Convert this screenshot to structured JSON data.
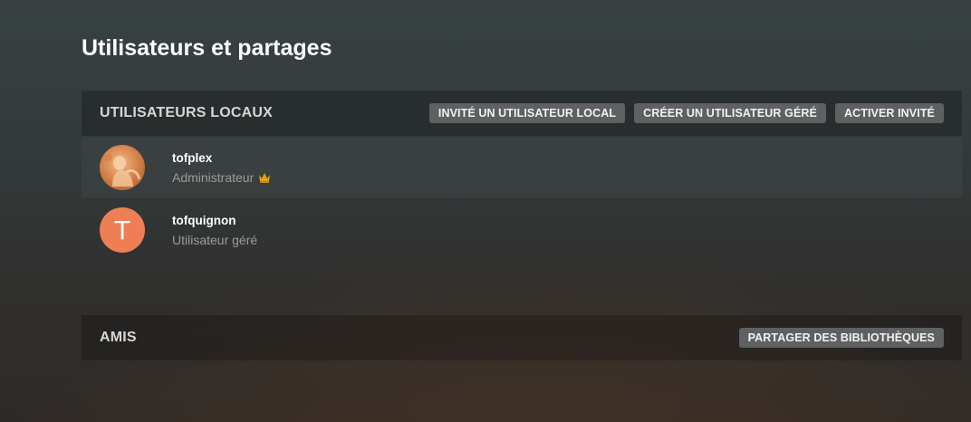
{
  "page": {
    "title": "Utilisateurs et partages"
  },
  "local_users": {
    "title": "UTILISATEURS LOCAUX",
    "actions": {
      "invite_label": "INVITÉ UN UTILISATEUR LOCAL",
      "create_managed_label": "CRÉER UN UTILISATEUR GÉRÉ",
      "enable_guest_label": "ACTIVER INVITÉ"
    },
    "users": [
      {
        "name": "tofplex",
        "role": "Administrateur",
        "avatar": "photo",
        "badge_icon": "crown-icon",
        "badge_color": "#e5a00d"
      },
      {
        "name": "tofquignon",
        "role": "Utilisateur géré",
        "avatar_letter": "T",
        "avatar_color": "#ee7f55"
      }
    ]
  },
  "friends": {
    "title": "AMIS",
    "actions": {
      "share_libraries_label": "PARTAGER DES BIBLIOTHÈQUES"
    }
  }
}
